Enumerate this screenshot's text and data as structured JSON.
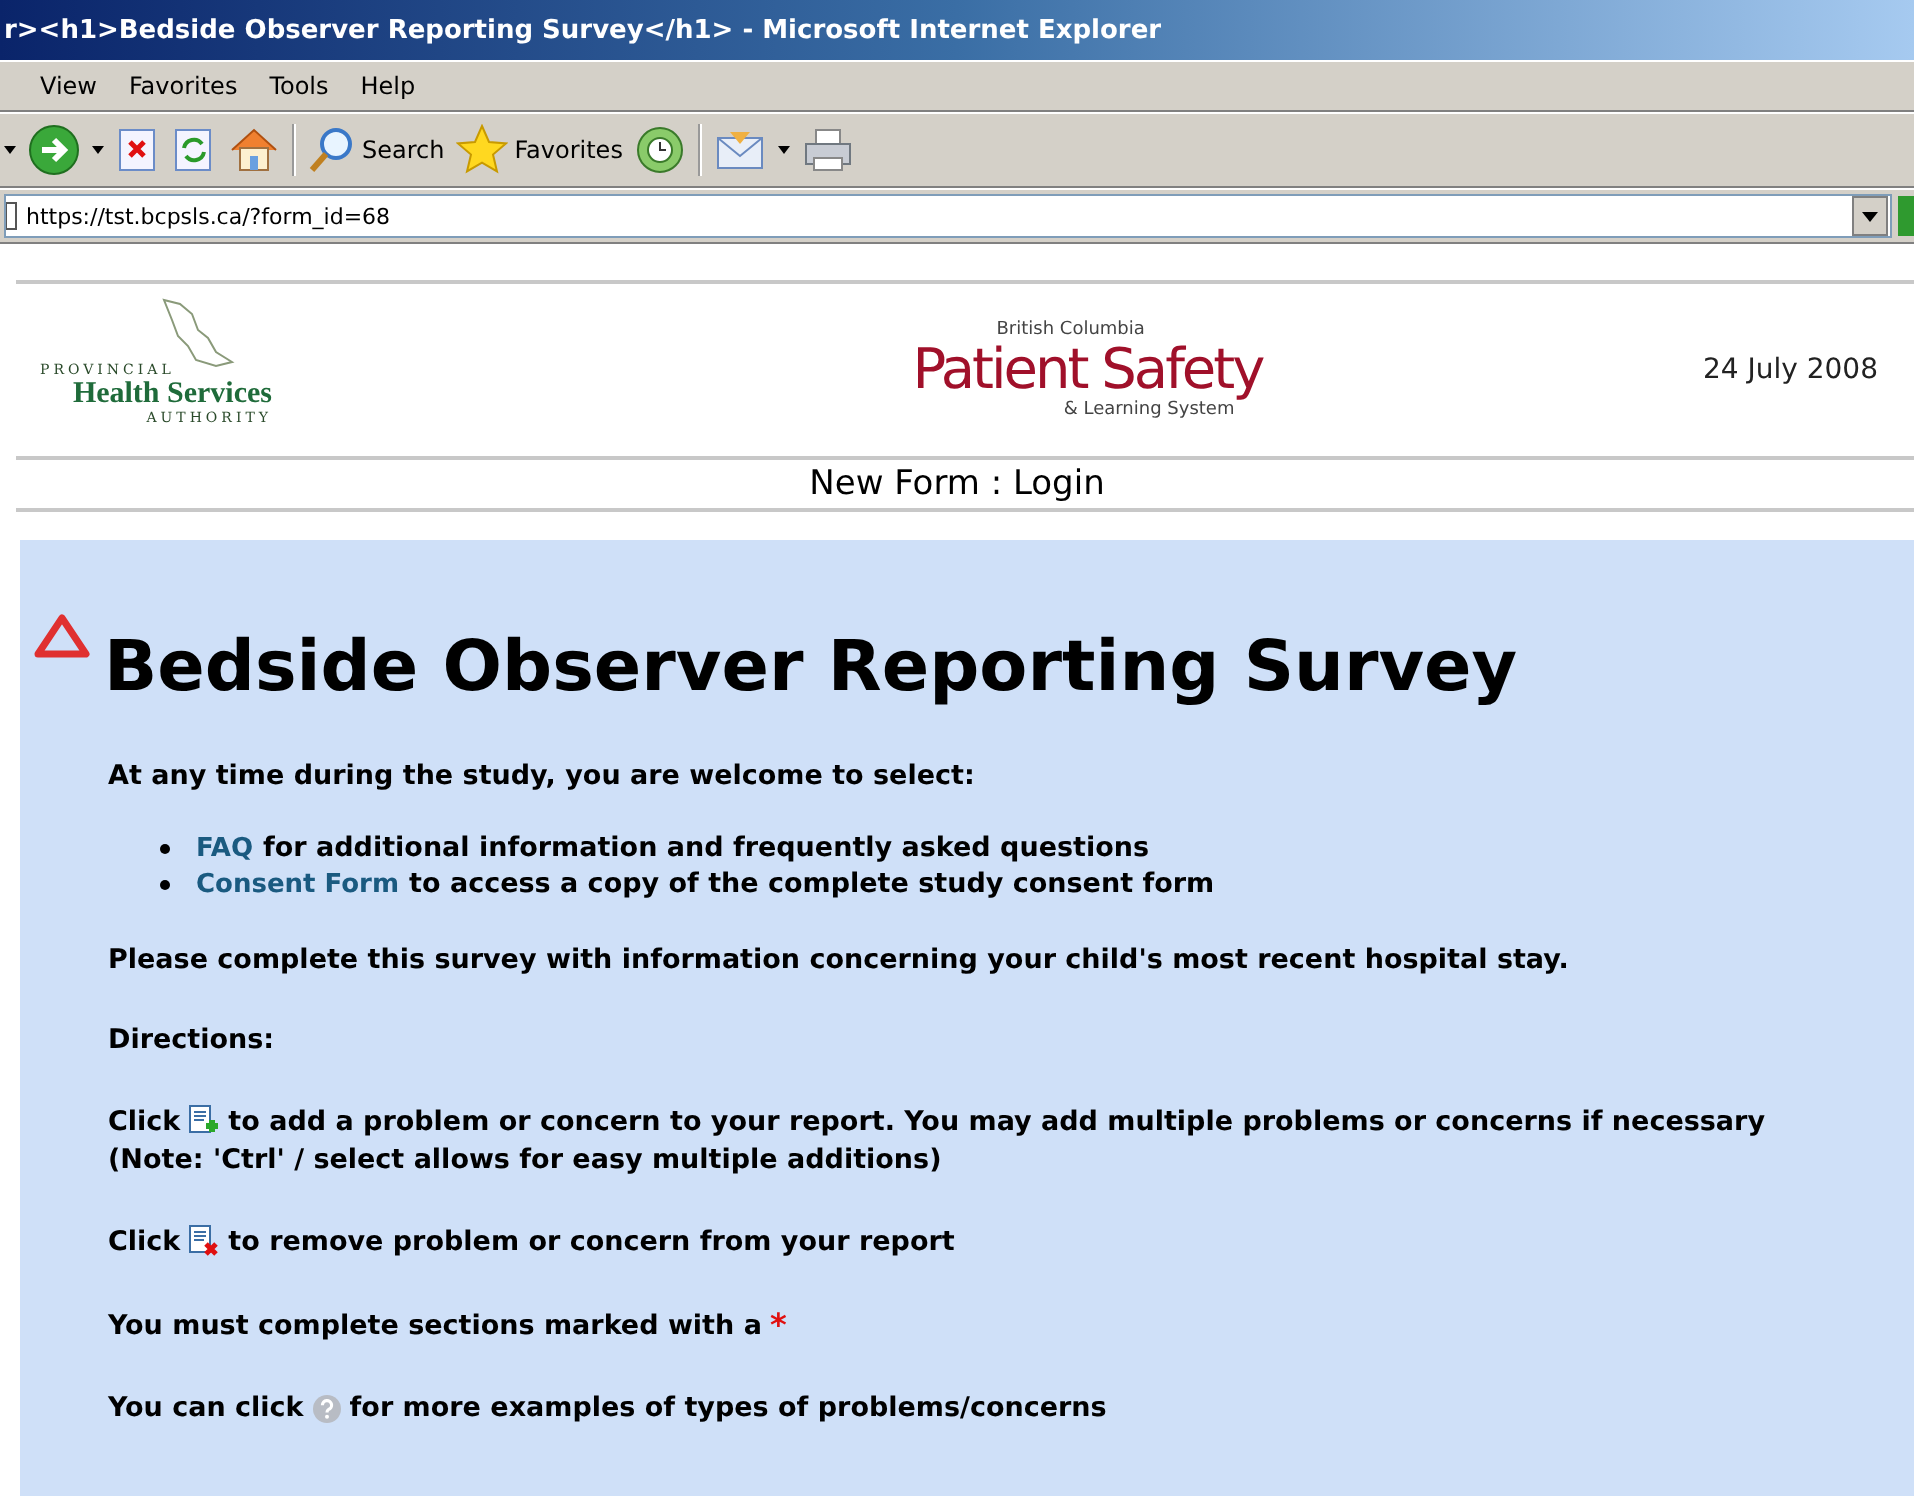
{
  "window": {
    "title": "r><h1>Bedside Observer Reporting Survey</h1> - Microsoft Internet Explorer"
  },
  "menu": [
    {
      "label": "View"
    },
    {
      "label": "Favorites"
    },
    {
      "label": "Tools"
    },
    {
      "label": "Help"
    }
  ],
  "toolbar": {
    "search": "Search",
    "favorites": "Favorites"
  },
  "address": {
    "value": "https://tst.bcpsls.ca/?form_id=68"
  },
  "header": {
    "left_logo": {
      "top": "PROVINCIAL",
      "name": "Health Services",
      "bottom": "AUTHORITY"
    },
    "center_logo": {
      "top": "British Columbia",
      "name": "Patient Safety",
      "bottom": "& Learning System"
    },
    "date": "24 July 2008"
  },
  "nav": "New Form : Login",
  "content": {
    "title": "Bedside Observer Reporting Survey",
    "intro": "At any time during the study, you are welcome to select:",
    "links": [
      {
        "link": "FAQ",
        "text": "for additional information and frequently asked questions"
      },
      {
        "link": "Consent Form",
        "text": "to access a copy of the complete study consent form"
      }
    ],
    "paragraph": "Please complete this survey with information concerning your child's most recent hospital stay.",
    "directions_label": "Directions:",
    "directions": [
      {
        "kind": "add",
        "before": "Click",
        "after": "to add a problem or concern to your report. You may add multiple problems or concerns if necessary",
        "note": "(Note: 'Ctrl' / select allows for easy multiple additions)"
      },
      {
        "kind": "remove",
        "before": "Click",
        "after": "to remove problem or concern from your report"
      },
      {
        "kind": "required",
        "before": "You must complete sections marked with a",
        "mark": "*"
      },
      {
        "kind": "help",
        "before": "You can click",
        "after": "for more examples of types of problems/concerns"
      }
    ]
  }
}
